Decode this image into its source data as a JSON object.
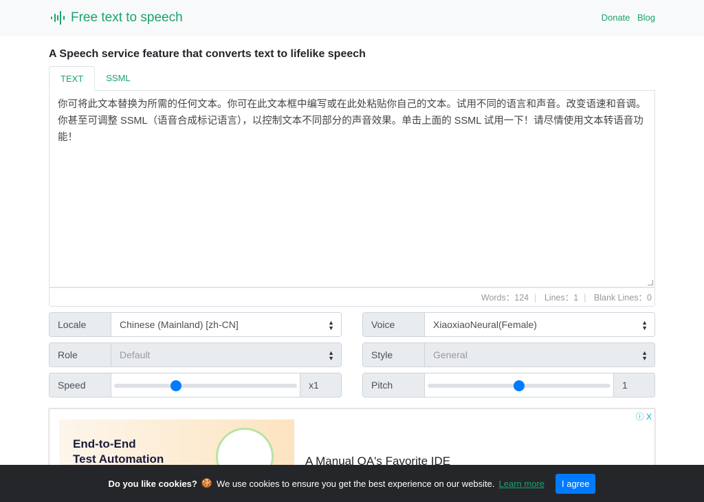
{
  "header": {
    "title": "Free text to speech",
    "nav": [
      "Donate",
      "Blog"
    ]
  },
  "main": {
    "heading": "A Speech service feature that converts text to lifelike speech",
    "tabs": [
      {
        "label": "TEXT",
        "active": true
      },
      {
        "label": "SSML",
        "active": false
      }
    ],
    "text": "你可将此文本替换为所需的任何文本。你可在此文本框中编写或在此处粘贴你自己的文本。试用不同的语言和声音。改变语速和音调。你甚至可调整 SSML（语音合成标记语言），以控制文本不同部分的声音效果。单击上面的 SSML 试用一下！请尽情使用文本转语音功能！",
    "stats": {
      "words": "Words：124",
      "lines": "Lines：1",
      "blank": "Blank Lines：0"
    },
    "controls": {
      "locale": {
        "label": "Locale",
        "value": "Chinese (Mainland) [zh-CN]"
      },
      "voice": {
        "label": "Voice",
        "value": "XiaoxiaoNeural(Female)"
      },
      "role": {
        "label": "Role",
        "value": "Default",
        "disabled": true
      },
      "style": {
        "label": "Style",
        "value": "General",
        "disabled": true
      },
      "speed": {
        "label": "Speed",
        "value": "x1",
        "fill_fraction": 0.34
      },
      "pitch": {
        "label": "Pitch",
        "value": "1",
        "fill_fraction": 0.5
      }
    },
    "ad": {
      "line1": "End-to-End",
      "line2": "Test Automation",
      "text": "A Manual QA's Favorite IDE",
      "close": "ⓘ X"
    }
  },
  "cookie": {
    "bold": "Do you like cookies?",
    "icon": "🍪",
    "text": "We use cookies to ensure you get the best experience on our website.",
    "link": "Learn more",
    "button": "I agree"
  },
  "colors": {
    "accent": "#1aa36b",
    "primary": "#007bff"
  }
}
